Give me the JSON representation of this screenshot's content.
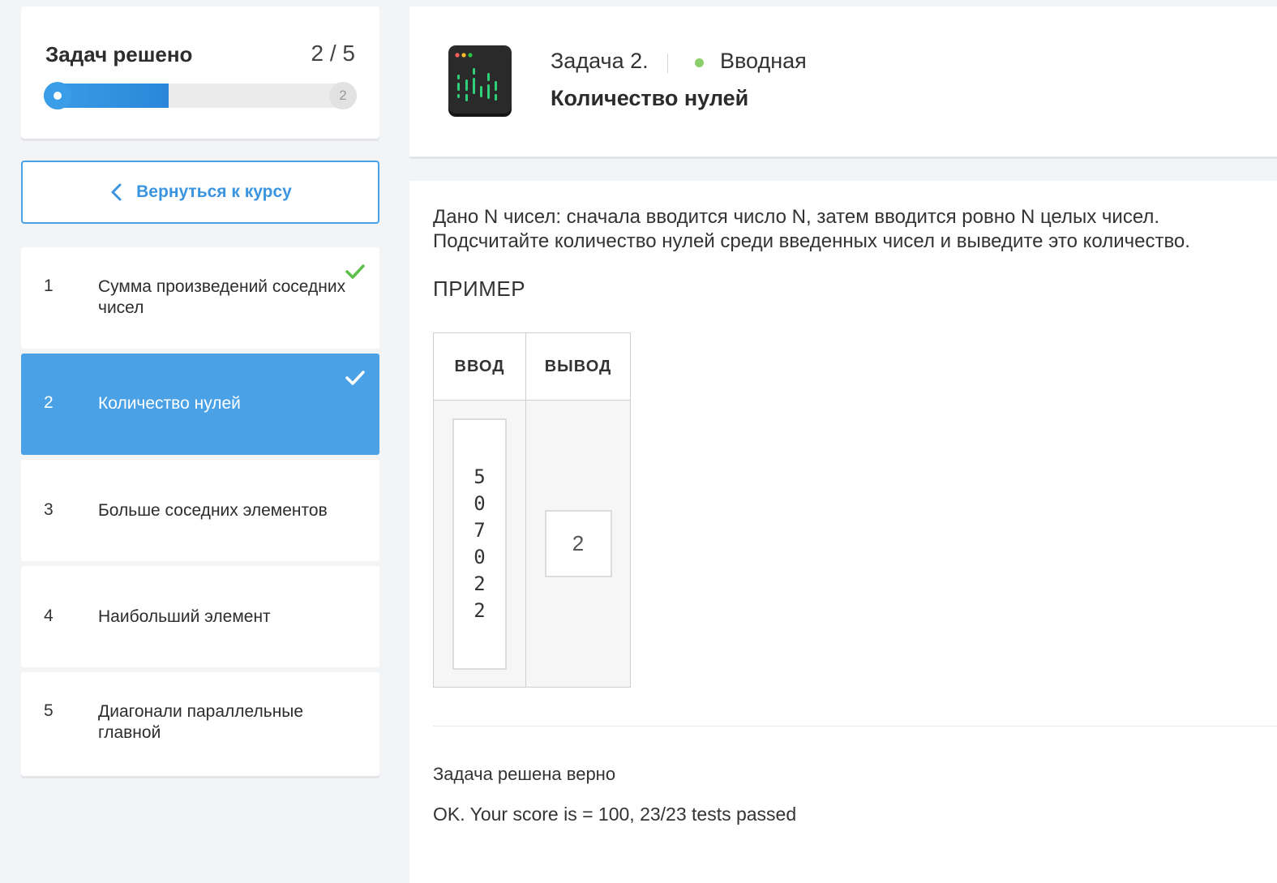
{
  "progress": {
    "title": "Задач решено",
    "count": "2 / 5",
    "solved": 2,
    "total": 5,
    "end_marker": "2"
  },
  "back_button": {
    "label": "Вернуться к курсу"
  },
  "tasks": [
    {
      "num": "1",
      "title": "Сумма произведений соседних чисел",
      "solved": true,
      "active": false
    },
    {
      "num": "2",
      "title": "Количество нулей",
      "solved": true,
      "active": true
    },
    {
      "num": "3",
      "title": "Больше соседних элементов",
      "solved": false,
      "active": false
    },
    {
      "num": "4",
      "title": "Наибольший элемент",
      "solved": false,
      "active": false
    },
    {
      "num": "5",
      "title": "Диагонали параллельные главной",
      "solved": false,
      "active": false
    }
  ],
  "header": {
    "task_label": "Задача 2.",
    "level": "Вводная",
    "task_name": "Количество нулей"
  },
  "statement": {
    "line1": "Дано N чисел: сначала вводится число N, затем вводится ровно N целых чисел.",
    "line2": "Подсчитайте количество нулей среди введенных чисел и выведите это количество."
  },
  "example": {
    "title": "ПРИМЕР",
    "input_header": "ВВОД",
    "output_header": "ВЫВОД",
    "input_lines": [
      "5",
      "0",
      "7",
      "0",
      "2",
      "2"
    ],
    "output": "2"
  },
  "result": {
    "status": "Задача решена верно",
    "score": "OK. Your score is = 100, 23/23 tests passed"
  },
  "colors": {
    "accent": "#4aa1e6",
    "check_green": "#5cc04a",
    "level_dot": "#8ccf6a"
  }
}
